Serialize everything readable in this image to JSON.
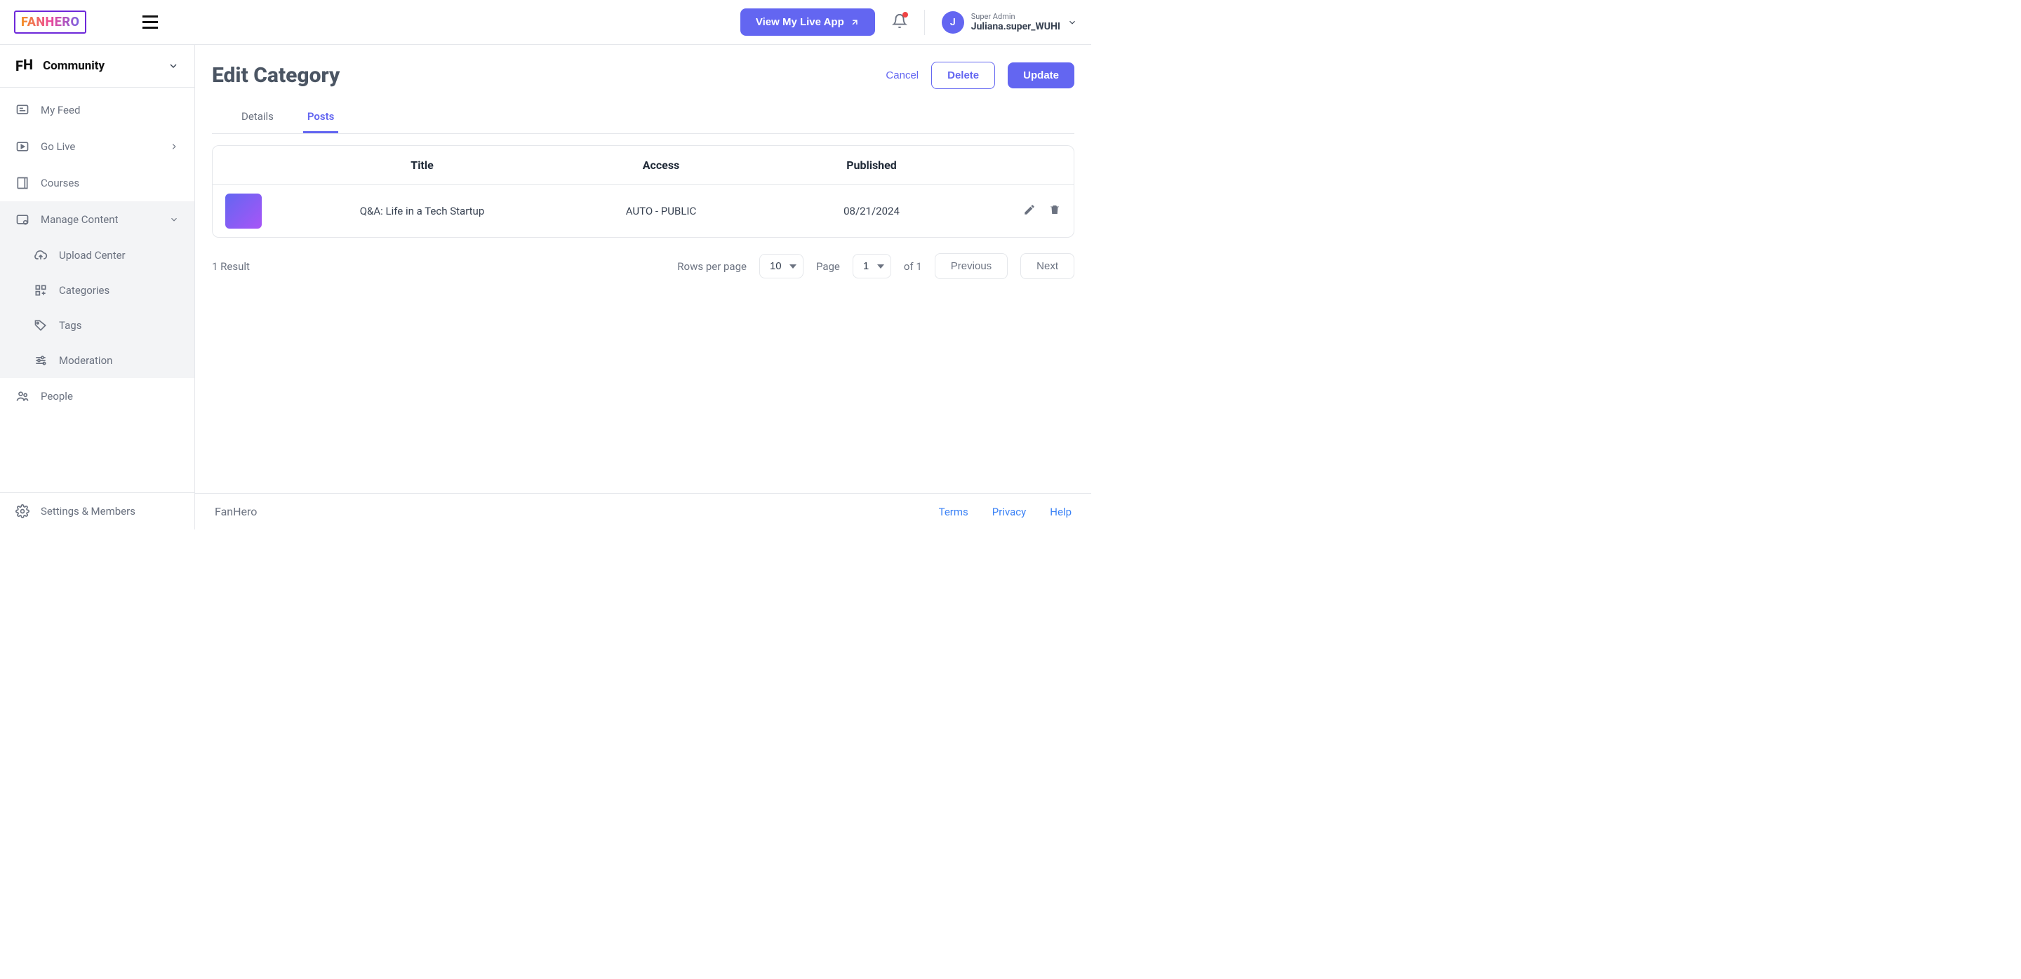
{
  "header": {
    "logo": "FANHERO",
    "view_app_label": "View My Live App",
    "user": {
      "role": "Super Admin",
      "name": "Juliana.super_WUHI",
      "initial": "J"
    }
  },
  "sidebar": {
    "workspace": "Community",
    "items": [
      {
        "label": "My Feed"
      },
      {
        "label": "Go Live"
      },
      {
        "label": "Courses"
      },
      {
        "label": "Manage Content"
      },
      {
        "label": "People"
      }
    ],
    "manage_content_children": [
      {
        "label": "Upload Center"
      },
      {
        "label": "Categories"
      },
      {
        "label": "Tags"
      },
      {
        "label": "Moderation"
      }
    ],
    "settings": "Settings & Members"
  },
  "page": {
    "title": "Edit Category",
    "actions": {
      "cancel": "Cancel",
      "delete": "Delete",
      "update": "Update"
    },
    "tabs": [
      {
        "label": "Details",
        "active": false
      },
      {
        "label": "Posts",
        "active": true
      }
    ]
  },
  "table": {
    "headers": {
      "title": "Title",
      "access": "Access",
      "published": "Published"
    },
    "rows": [
      {
        "title": "Q&A: Life in a Tech Startup",
        "access": "AUTO - PUBLIC",
        "published": "08/21/2024"
      }
    ]
  },
  "pagination": {
    "result_text": "1 Result",
    "rows_label": "Rows per page",
    "rows_value": "10",
    "page_label": "Page",
    "page_value": "1",
    "of_text": "of 1",
    "prev": "Previous",
    "next": "Next"
  },
  "footer": {
    "brand": "FanHero",
    "links": {
      "terms": "Terms",
      "privacy": "Privacy",
      "help": "Help"
    }
  }
}
